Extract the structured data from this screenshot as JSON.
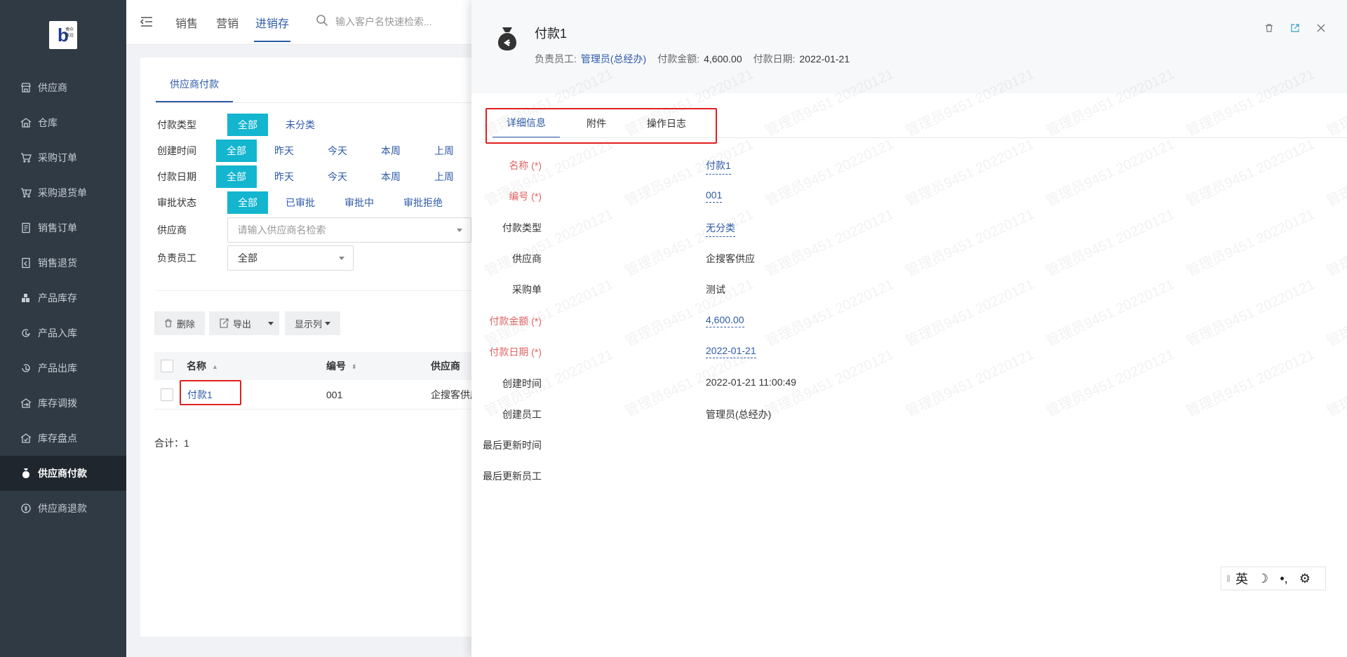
{
  "sidebar": {
    "logo_text": "博众致远",
    "items": [
      {
        "label": "供应商",
        "icon": "shop-icon"
      },
      {
        "label": "仓库",
        "icon": "warehouse-icon"
      },
      {
        "label": "采购订单",
        "icon": "cart-icon"
      },
      {
        "label": "采购退货单",
        "icon": "cart-return-icon"
      },
      {
        "label": "销售订单",
        "icon": "document-icon"
      },
      {
        "label": "销售退货",
        "icon": "document-return-icon"
      },
      {
        "label": "产品库存",
        "icon": "stock-icon"
      },
      {
        "label": "产品入库",
        "icon": "inbound-icon"
      },
      {
        "label": "产品出库",
        "icon": "outbound-icon"
      },
      {
        "label": "库存调拨",
        "icon": "transfer-icon"
      },
      {
        "label": "库存盘点",
        "icon": "inventory-check-icon"
      },
      {
        "label": "供应商付款",
        "icon": "money-bag-icon",
        "active": true
      },
      {
        "label": "供应商退款",
        "icon": "refund-icon"
      }
    ]
  },
  "topbar": {
    "tabs": [
      "销售",
      "营销",
      "进销存"
    ],
    "active_tab": "进销存",
    "search_placeholder": "输入客户名快速检索..."
  },
  "page": {
    "tab": "供应商付款",
    "filters": {
      "payment_type": {
        "label": "付款类型",
        "options": [
          "全部",
          "未分类"
        ]
      },
      "created_time": {
        "label": "创建时间",
        "options": [
          "全部",
          "昨天",
          "今天",
          "本周",
          "上周"
        ]
      },
      "payment_date": {
        "label": "付款日期",
        "options": [
          "全部",
          "昨天",
          "今天",
          "本周",
          "上周"
        ]
      },
      "approval": {
        "label": "审批状态",
        "options": [
          "全部",
          "已审批",
          "审批中",
          "审批拒绝"
        ]
      },
      "supplier": {
        "label": "供应商",
        "placeholder": "请输入供应商名检索"
      },
      "owner": {
        "label": "负责员工",
        "value": "全部"
      }
    },
    "toolbar": {
      "delete": "删除",
      "export": "导出",
      "columns": "显示列"
    },
    "table": {
      "headers": [
        "名称",
        "编号",
        "供应商"
      ],
      "rows": [
        {
          "name": "付款1",
          "code": "001",
          "supplier": "企搜客供应"
        }
      ]
    },
    "total": "合计：1"
  },
  "drawer": {
    "title": "付款1",
    "meta": {
      "owner_label": "负责员工:",
      "owner": "管理员(总经办)",
      "amount_label": "付款金额:",
      "amount": "4,600.00",
      "date_label": "付款日期:",
      "date": "2022-01-21"
    },
    "tabs": [
      "详细信息",
      "附件",
      "操作日志"
    ],
    "fields": [
      {
        "label": "名称 (*)",
        "value": "付款1",
        "required": true,
        "editable": true
      },
      {
        "label": "编号 (*)",
        "value": "001",
        "required": true,
        "editable": true
      },
      {
        "label": "付款类型",
        "value": "无分类",
        "required": false,
        "editable": true
      },
      {
        "label": "供应商",
        "value": "企搜客供应",
        "required": false,
        "editable": false
      },
      {
        "label": "采购单",
        "value": "测试",
        "required": false,
        "editable": false
      },
      {
        "label": "付款金额 (*)",
        "value": "4,600.00",
        "required": true,
        "editable": true
      },
      {
        "label": "付款日期 (*)",
        "value": "2022-01-21",
        "required": true,
        "editable": true
      },
      {
        "label": "创建时间",
        "value": "2022-01-21 11:00:49",
        "required": false,
        "editable": false
      },
      {
        "label": "创建员工",
        "value": "管理员(总经办)",
        "required": false,
        "editable": false
      },
      {
        "label": "最后更新时间",
        "value": "",
        "required": false,
        "editable": false
      },
      {
        "label": "最后更新员工",
        "value": "",
        "required": false,
        "editable": false
      }
    ],
    "watermark": "管理员9451 20220121"
  },
  "ime": {
    "lang": "英",
    "moon": "☽",
    "punct": "•,",
    "settings": "⚙"
  },
  "colors": {
    "accent": "#13b5cf",
    "link": "#2e5aa8",
    "sidebar": "#2f3a45",
    "required": "#e06363",
    "highlight": "#e02020"
  }
}
